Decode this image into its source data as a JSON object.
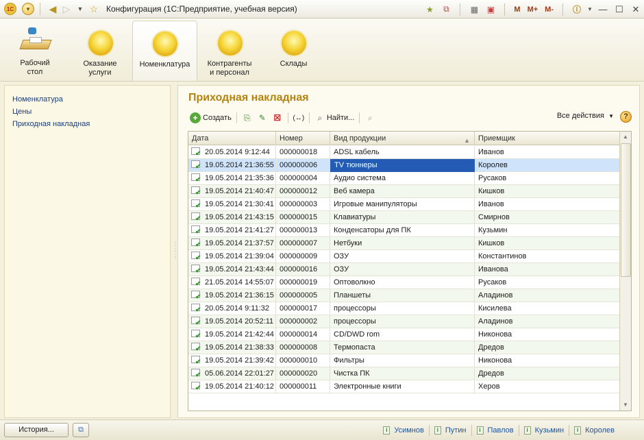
{
  "window": {
    "title": "Конфигурация  (1С:Предприятие, учебная версия)",
    "logo_text": "1С",
    "memory_buttons": [
      "M",
      "M+",
      "M-"
    ]
  },
  "sections": [
    {
      "label": "Рабочий стол",
      "icon": "desktop-icon"
    },
    {
      "label": "Оказание услуги",
      "icon": "section-icon"
    },
    {
      "label": "Номенклатура",
      "icon": "section-icon",
      "active": true
    },
    {
      "label": "Контрагенты и персонал",
      "icon": "section-icon"
    },
    {
      "label": "Склады",
      "icon": "section-icon"
    }
  ],
  "left_nav": {
    "items": [
      "Номенклатура",
      "Цены",
      "Приходная накладная"
    ]
  },
  "form": {
    "title": "Приходная накладная",
    "toolbar": {
      "create": "Создать",
      "find": "Найти...",
      "all_actions": "Все действия",
      "help": "?"
    },
    "columns": [
      "Дата",
      "Номер",
      "Вид продукции",
      "Приемщик"
    ],
    "rows": [
      {
        "date": "20.05.2014 9:12:44",
        "number": "000000018",
        "type": "ADSL кабель",
        "receiver": "Иванов"
      },
      {
        "date": "19.05.2014 21:36:55",
        "number": "000000006",
        "type": "TV тюннеры",
        "receiver": "Королев",
        "selected": true
      },
      {
        "date": "19.05.2014 21:35:36",
        "number": "000000004",
        "type": "Аудио система",
        "receiver": "Русаков"
      },
      {
        "date": "19.05.2014 21:40:47",
        "number": "000000012",
        "type": "Веб камера",
        "receiver": "Кишков"
      },
      {
        "date": "19.05.2014 21:30:41",
        "number": "000000003",
        "type": "Игровые манипуляторы",
        "receiver": "Иванов"
      },
      {
        "date": "19.05.2014 21:43:15",
        "number": "000000015",
        "type": "Клавиатуры",
        "receiver": "Смирнов"
      },
      {
        "date": "19.05.2014 21:41:27",
        "number": "000000013",
        "type": "Конденсаторы для ПК",
        "receiver": "Кузьмин"
      },
      {
        "date": "19.05.2014 21:37:57",
        "number": "000000007",
        "type": "Нетбуки",
        "receiver": "Кишков"
      },
      {
        "date": "19.05.2014 21:39:04",
        "number": "000000009",
        "type": "ОЗУ",
        "receiver": "Константинов"
      },
      {
        "date": "19.05.2014 21:43:44",
        "number": "000000016",
        "type": "ОЗУ",
        "receiver": "Иванова"
      },
      {
        "date": "21.05.2014 14:55:07",
        "number": "000000019",
        "type": "Оптоволкно",
        "receiver": "Русаков"
      },
      {
        "date": "19.05.2014 21:36:15",
        "number": "000000005",
        "type": "Планшеты",
        "receiver": "Аладинов"
      },
      {
        "date": "20.05.2014 9:11:32",
        "number": "000000017",
        "type": "процессоры",
        "receiver": "Кисилева"
      },
      {
        "date": "19.05.2014 20:52:11",
        "number": "000000002",
        "type": "процессоры",
        "receiver": "Аладинов"
      },
      {
        "date": "19.05.2014 21:42:44",
        "number": "000000014",
        "type": "CD/DWD rom",
        "receiver": "Никонова"
      },
      {
        "date": "19.05.2014 21:38:33",
        "number": "000000008",
        "type": "Термопаста",
        "receiver": "Дредов"
      },
      {
        "date": "19.05.2014 21:39:42",
        "number": "000000010",
        "type": "Фильтры",
        "receiver": "Никонова"
      },
      {
        "date": "05.06.2014 22:01:27",
        "number": "000000020",
        "type": "Чистка ПК",
        "receiver": "Дредов"
      },
      {
        "date": "19.05.2014 21:40:12",
        "number": "000000011",
        "type": "Электронные книги",
        "receiver": "Херов"
      }
    ]
  },
  "statusbar": {
    "history_button": "История...",
    "history_links": [
      "Усимнов",
      "Путин",
      "Павлов",
      "Кузьмин",
      "Королев"
    ]
  },
  "colors": {
    "accent_title": "#b4840f",
    "selection": "#cfe3fa",
    "selected_cell": "#235bb5",
    "alt_row": "#f3f8ee"
  }
}
